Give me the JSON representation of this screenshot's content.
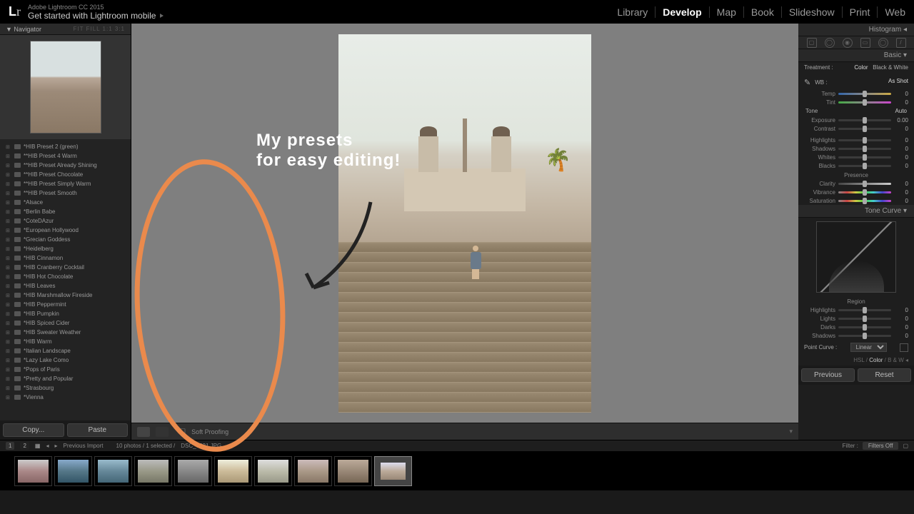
{
  "title": {
    "brand": "Adobe Lightroom CC 2015",
    "tagline": "Get started with Lightroom mobile",
    "logo": "Lr"
  },
  "modules": [
    {
      "label": "Library",
      "active": false
    },
    {
      "label": "Develop",
      "active": true
    },
    {
      "label": "Map",
      "active": false
    },
    {
      "label": "Book",
      "active": false
    },
    {
      "label": "Slideshow",
      "active": false
    },
    {
      "label": "Print",
      "active": false
    },
    {
      "label": "Web",
      "active": false
    }
  ],
  "navigator": {
    "label": "Navigator",
    "zooms": "FIT  FILL  1:1  3:1"
  },
  "presets": [
    "*HIB Preset 2 (green)",
    "**HIB Preset 4 Warm",
    "**HIB Preset Already Shining",
    "**HIB Preset Chocolate",
    "**HIB Preset Simply Warm",
    "**HIB Preset Smooth",
    "*Alsace",
    "*Berlin Babe",
    "*CoteDAzur",
    "*European Hollywood",
    "*Grecian Goddess",
    "*Heidelberg",
    "*HIB Cinnamon",
    "*HIB Cranberry Cocktail",
    "*HIB Hot Chocolate",
    "*HIB Leaves",
    "*HIB Marshmallow Fireside",
    "*HIB Peppermint",
    "*HIB Pumpkin",
    "*HIB Spiced Cider",
    "*HIB Sweater Weather",
    "*HIB Warm",
    "*Italian Landscape",
    "*Lazy Lake Como",
    "*Pops of Paris",
    "*Pretty and Popular",
    "*Strasbourg",
    "*Vienna"
  ],
  "buttons": {
    "copy": "Copy...",
    "paste": "Paste",
    "previous": "Previous",
    "reset": "Reset"
  },
  "annotation": {
    "line1": "My presets",
    "line2": "for easy editing!"
  },
  "toolbar": {
    "softproof": "Soft Proofing"
  },
  "right": {
    "histogram": "Histogram",
    "basic": "Basic",
    "treatment": {
      "label": "Treatment :",
      "color": "Color",
      "bw": "Black & White"
    },
    "wb": {
      "label": "WB :",
      "value": "As Shot"
    },
    "sliders_wb": [
      {
        "label": "Temp",
        "val": "0",
        "grad": "grad1"
      },
      {
        "label": "Tint",
        "val": "0",
        "grad": "grad2"
      }
    ],
    "tone": {
      "label": "Tone",
      "auto": "Auto"
    },
    "sliders_tone": [
      {
        "label": "Exposure",
        "val": "0.00"
      },
      {
        "label": "Contrast",
        "val": "0"
      }
    ],
    "sliders_tone2": [
      {
        "label": "Highlights",
        "val": "0"
      },
      {
        "label": "Shadows",
        "val": "0"
      },
      {
        "label": "Whites",
        "val": "0"
      },
      {
        "label": "Blacks",
        "val": "0"
      }
    ],
    "presence": "Presence",
    "sliders_presence": [
      {
        "label": "Clarity",
        "val": "0",
        "grad": "gradC"
      },
      {
        "label": "Vibrance",
        "val": "0",
        "grad": "gradS"
      },
      {
        "label": "Saturation",
        "val": "0",
        "grad": "gradS"
      }
    ],
    "tonecurve": "Tone Curve",
    "region": "Region",
    "sliders_region": [
      {
        "label": "Highlights",
        "val": "0"
      },
      {
        "label": "Lights",
        "val": "0"
      },
      {
        "label": "Darks",
        "val": "0"
      },
      {
        "label": "Shadows",
        "val": "0"
      }
    ],
    "pointcurve": {
      "label": "Point Curve :",
      "value": "Linear"
    },
    "hsl": {
      "hsl": "HSL",
      "sep": "/",
      "color": "Color",
      "bw": "B & W"
    }
  },
  "filmstrip": {
    "prev_import": "Previous Import",
    "count": "10 photos / 1 selected /",
    "filename": "DSC_0521.JPG",
    "filter": "Filter :",
    "filters_off": "Filters Off"
  }
}
